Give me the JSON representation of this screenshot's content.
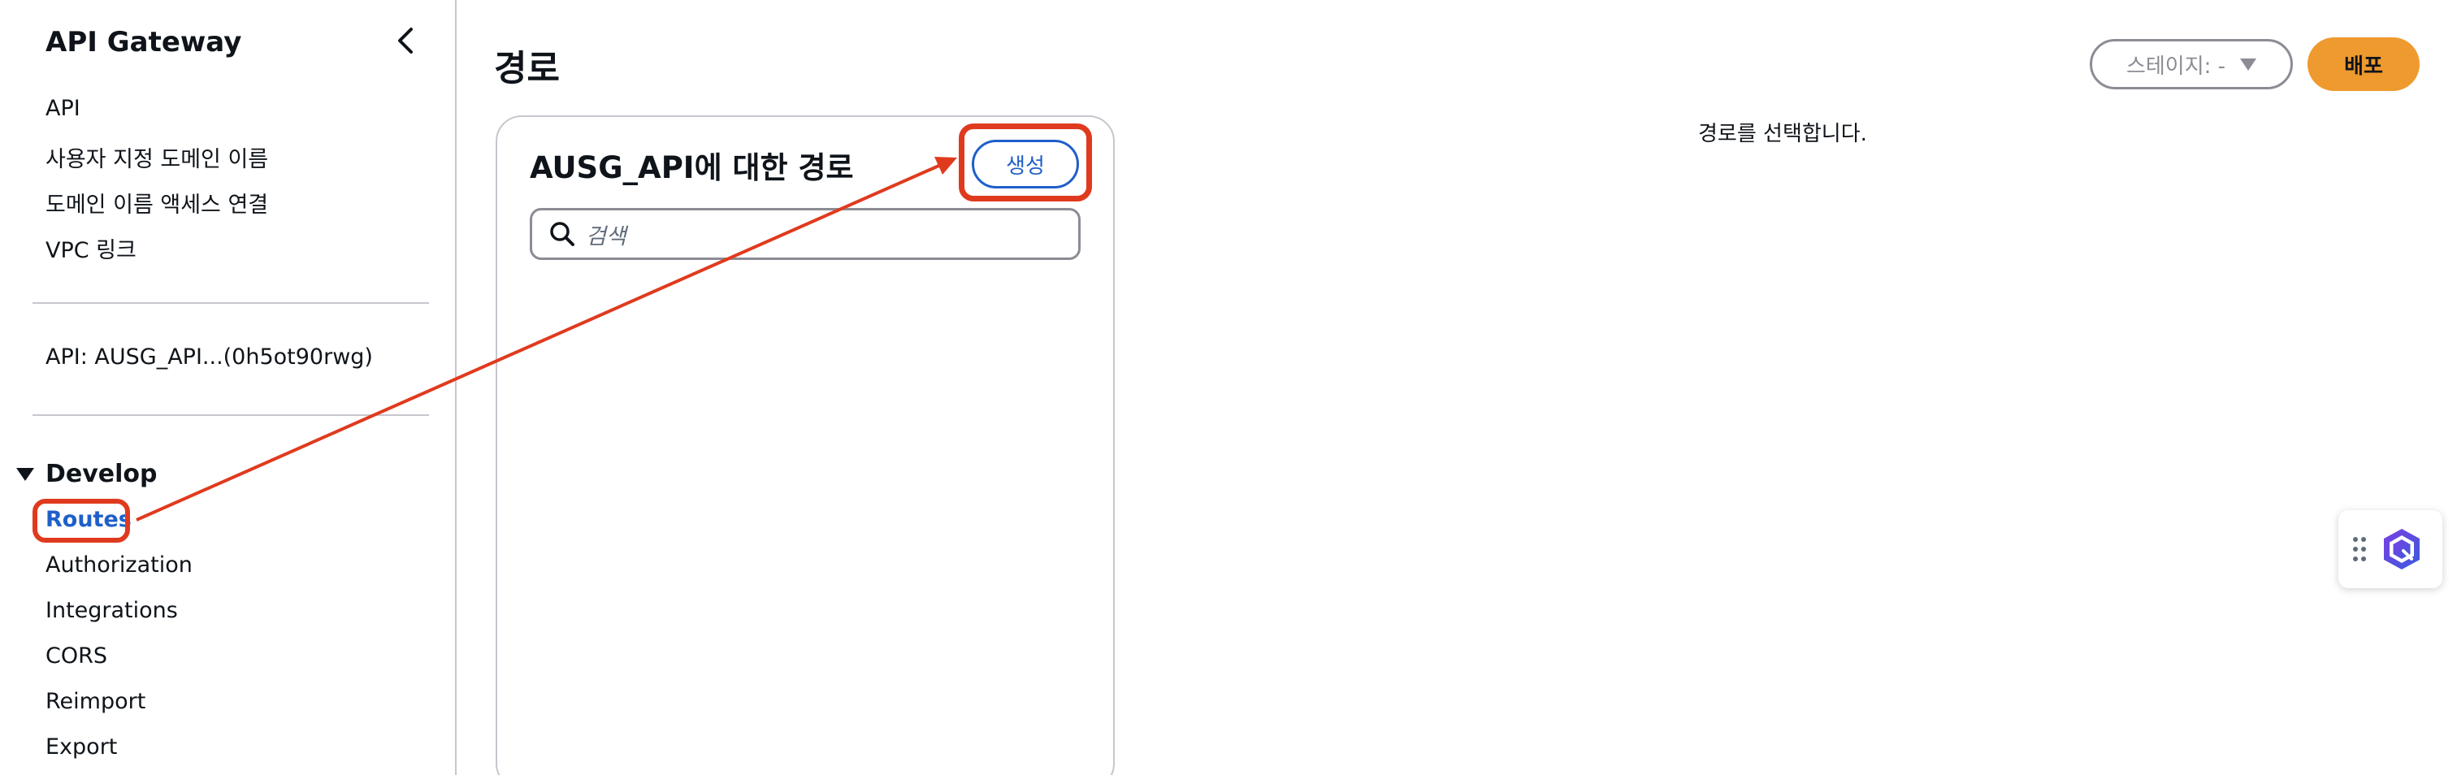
{
  "sidebar": {
    "title": "API Gateway",
    "links": [
      "API",
      "사용자 지정 도메인 이름",
      "도메인 이름 액세스 연결",
      "VPC 링크"
    ],
    "api_label": "API: AUSG_API...(0h5ot90rwg)",
    "section_title": "Develop",
    "develop_items": [
      "Routes",
      "Authorization",
      "Integrations",
      "CORS",
      "Reimport",
      "Export"
    ]
  },
  "header": {
    "title": "경로",
    "stage_label": "스테이지: -",
    "deploy_label": "배포"
  },
  "routes_panel": {
    "title": "AUSG_API에 대한 경로",
    "create_label": "생성",
    "search_placeholder": "검색"
  },
  "detail": {
    "message": "경로를 선택합니다."
  },
  "colors": {
    "accent_blue": "#1f5fc9",
    "deploy_orange": "#ef9a2e",
    "annotation_red": "#e03a1e"
  }
}
